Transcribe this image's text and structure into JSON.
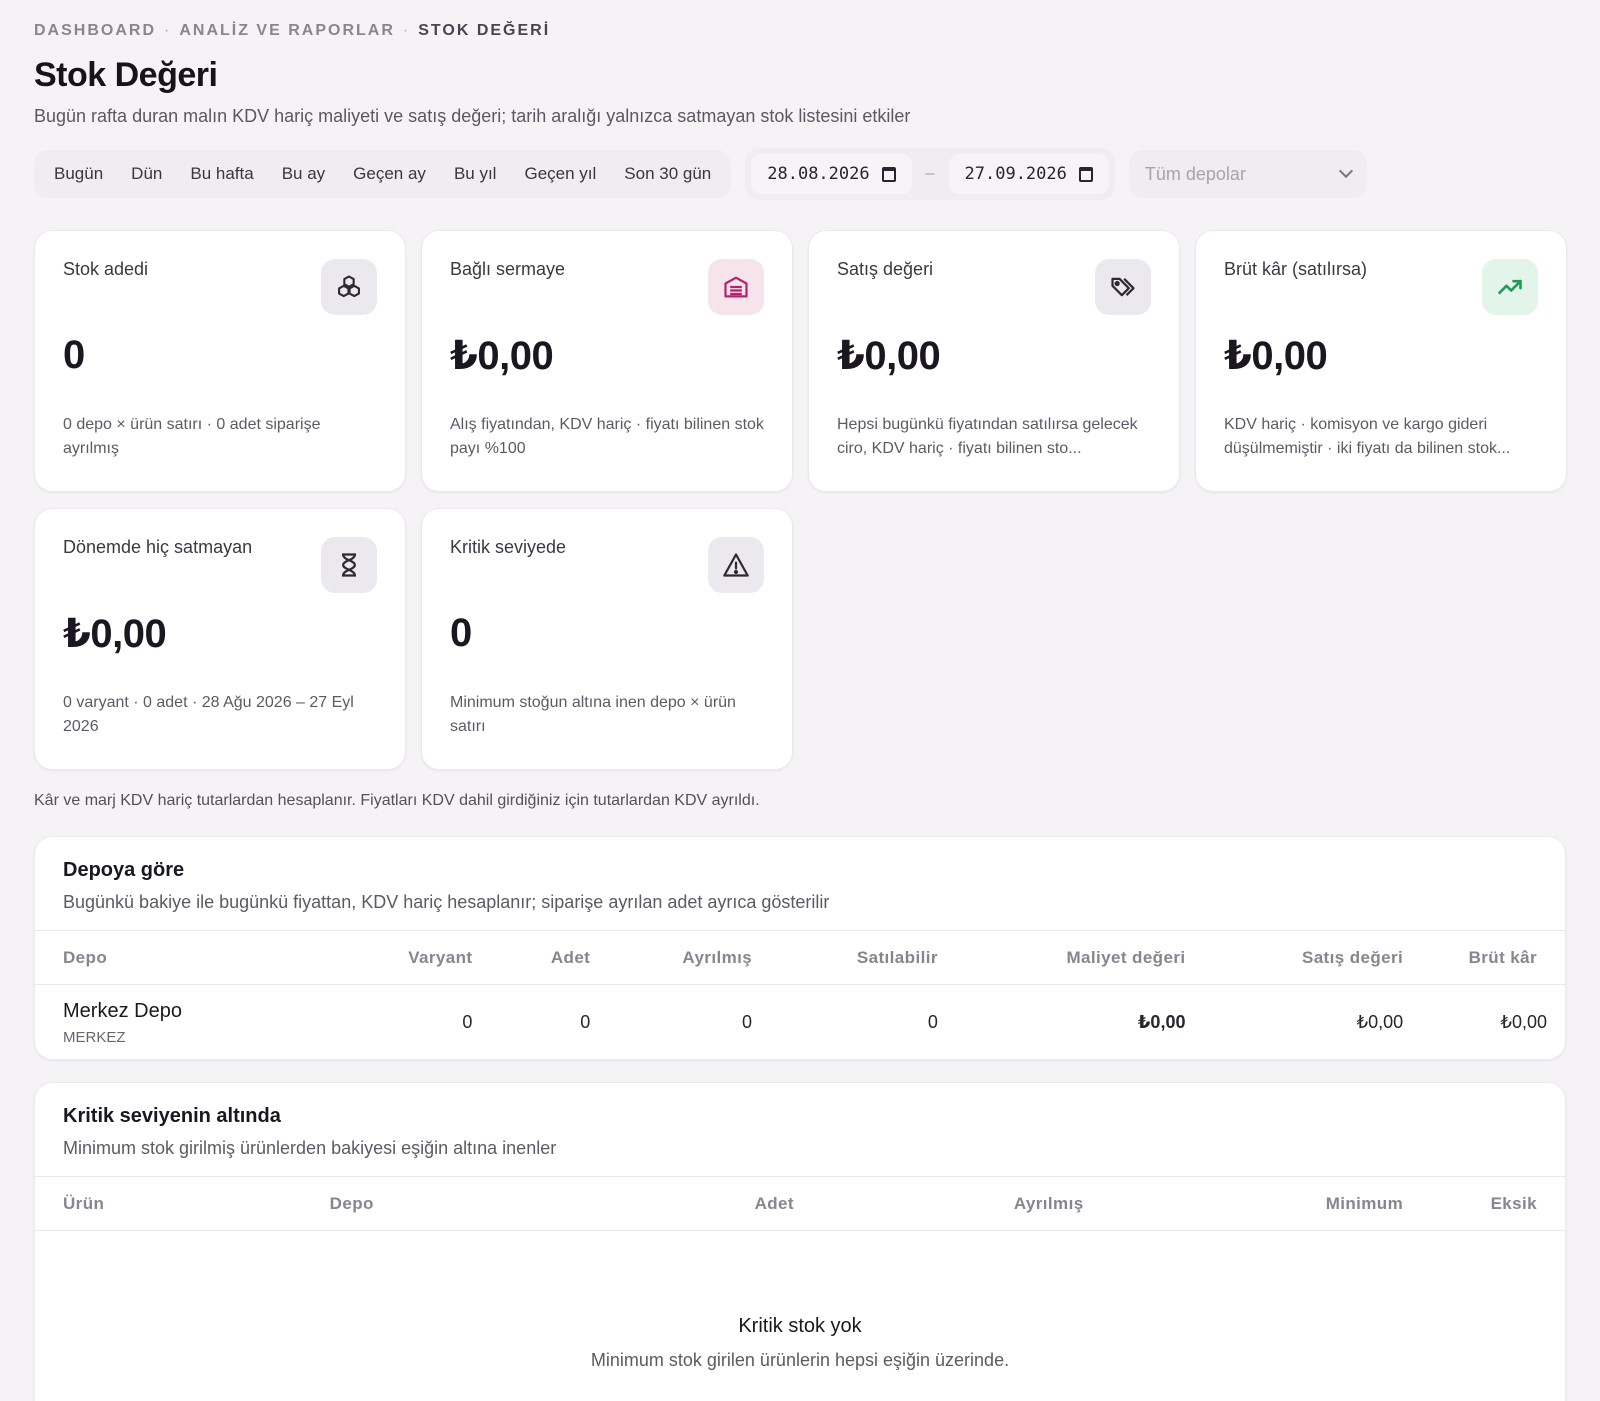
{
  "breadcrumb": {
    "items": [
      "DASHBOARD",
      "ANALİZ VE RAPORLAR",
      "STOK DEĞERİ"
    ],
    "separator": "·"
  },
  "header": {
    "title": "Stok Değeri",
    "subtitle": "Bugün rafta duran malın KDV hariç maliyeti ve satış değeri; tarih aralığı yalnızca satmayan stok listesini etkiler"
  },
  "filters": {
    "presets": [
      "Bugün",
      "Dün",
      "Bu hafta",
      "Bu ay",
      "Geçen ay",
      "Bu yıl",
      "Geçen yıl",
      "Son 30 gün"
    ],
    "date_from": "28.08.2026",
    "date_to": "27.09.2026",
    "date_separator": "–",
    "depot_placeholder": "Tüm depolar"
  },
  "kpis": [
    {
      "label": "Stok adedi",
      "value": "0",
      "note": "0 depo × ürün satırı · 0 adet siparişe ayrılmış",
      "icon": "boxes-icon",
      "tone": "gray"
    },
    {
      "label": "Bağlı sermaye",
      "value": "₺0,00",
      "note": "Alış fiyatından, KDV hariç · fiyatı bilinen stok payı %100",
      "icon": "warehouse-icon",
      "tone": "pink"
    },
    {
      "label": "Satış değeri",
      "value": "₺0,00",
      "note": "Hepsi bugünkü fiyatından satılırsa gelecek ciro, KDV hariç · fiyatı bilinen sto...",
      "icon": "tags-icon",
      "tone": "gray"
    },
    {
      "label": "Brüt kâr (satılırsa)",
      "value": "₺0,00",
      "note": "KDV hariç · komisyon ve kargo gideri düşülmemiştir · iki fiyatı da bilinen stok...",
      "icon": "trending-up-icon",
      "tone": "green"
    },
    {
      "label": "Dönemde hiç satmayan",
      "value": "₺0,00",
      "note": "0 varyant · 0 adet · 28 Ağu 2026 – 27 Eyl 2026",
      "icon": "hourglass-icon",
      "tone": "gray"
    },
    {
      "label": "Kritik seviyede",
      "value": "0",
      "note": "Minimum stoğun altına inen depo × ürün satırı",
      "icon": "warning-icon",
      "tone": "gray"
    }
  ],
  "vat_note": "Kâr ve marj KDV hariç tutarlardan hesaplanır. Fiyatları KDV dahil girdiğiniz için tutarlardan KDV ayrıldı.",
  "by_depot": {
    "title": "Depoya göre",
    "subtitle": "Bugünkü bakiye ile bugünkü fiyattan, KDV hariç hesaplanır; siparişe ayrılan adet ayrıca gösterilir",
    "columns": [
      "Depo",
      "Varyant",
      "Adet",
      "Ayrılmış",
      "Satılabilir",
      "Maliyet değeri",
      "Satış değeri",
      "Brüt kâr"
    ],
    "rows": [
      {
        "name": "Merkez Depo",
        "code": "MERKEZ",
        "variant": "0",
        "qty": "0",
        "reserved": "0",
        "sellable": "0",
        "cost": "₺0,00",
        "sales": "₺0,00",
        "gross": "₺0,00"
      }
    ]
  },
  "critical": {
    "title": "Kritik seviyenin altında",
    "subtitle": "Minimum stok girilmiş ürünlerden bakiyesi eşiğin altına inenler",
    "columns": [
      "Ürün",
      "Depo",
      "Adet",
      "Ayrılmış",
      "Minimum",
      "Eksik"
    ],
    "empty_title": "Kritik stok yok",
    "empty_sub": "Minimum stok girilen ürünlerin hepsi eşiğin üzerinde."
  },
  "colors": {
    "background": "#f5f3f6",
    "accent_pink": "#b3236b",
    "accent_green": "#1f9a55"
  }
}
